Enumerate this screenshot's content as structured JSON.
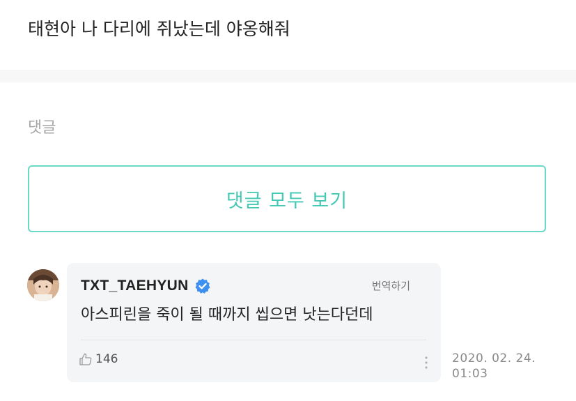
{
  "post": {
    "text": "태현아 나 다리에 쥐났는데 야옹해줘"
  },
  "comments_section": {
    "label": "댓글",
    "view_all_label": "댓글 모두 보기"
  },
  "comment": {
    "author": "TXT_TAEHYUN",
    "verified": true,
    "translate_label": "번역하기",
    "body": "아스피린을 죽이 될 때까지 씹으면 낫는다던데",
    "likes": "146",
    "date": "2020. 02. 24.",
    "time": "01:03"
  },
  "icons": {
    "verified": "verified-check-icon",
    "like": "thumbs-up-icon",
    "more": "more-vertical-icon"
  },
  "colors": {
    "accent": "#43c9b3",
    "accent_border": "#6bd9c7",
    "verified_blue": "#3d8ff0",
    "bubble_bg": "#f4f5f7"
  }
}
